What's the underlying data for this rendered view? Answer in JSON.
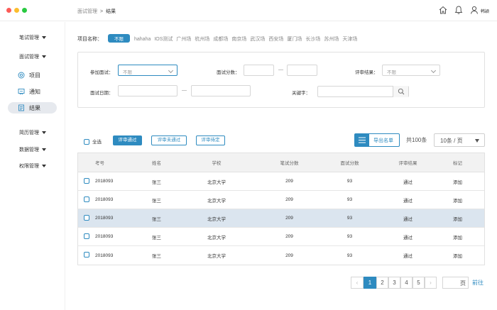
{
  "header": {
    "breadcrumb_parent": "面试管理",
    "breadcrumb_sep": ">",
    "breadcrumb_current": "结果",
    "user_name": "韩颖",
    "icons": [
      "home-icon",
      "bell-icon",
      "user-icon"
    ]
  },
  "sidebar": {
    "groups": [
      {
        "label": "笔试管理"
      },
      {
        "label": "面试管理"
      },
      {
        "label": "简历管理"
      },
      {
        "label": "数据管理"
      },
      {
        "label": "权限管理"
      }
    ],
    "items": [
      {
        "label": "项目",
        "icon": "project-icon"
      },
      {
        "label": "通知",
        "icon": "notice-icon"
      },
      {
        "label": "结果",
        "icon": "result-icon",
        "active": true
      }
    ]
  },
  "project": {
    "label": "项目名称：",
    "selected": "不限",
    "options": [
      "hahaha",
      "IOS测试",
      "广州场",
      "杭州场",
      "成都场",
      "南京场",
      "武汉场",
      "西安场",
      "厦门场",
      "长沙场",
      "苏州场",
      "天津场"
    ]
  },
  "filters": {
    "interview_label": "参加面试：",
    "interview_value": "不限",
    "score_label": "面试分数：",
    "score_dash": "—",
    "result_label": "评审结果：",
    "result_value": "不限",
    "date_label": "面试日期：",
    "date_dash": "—",
    "keyword_label": "关键字："
  },
  "actions": {
    "select_all": "全选",
    "pass": "评审通过",
    "fail": "评审未通过",
    "pending": "评审待定",
    "export": "导出名单",
    "total": "共100条",
    "page_size": "10条 / 页"
  },
  "table": {
    "headers": [
      "考号",
      "姓名",
      "学校",
      "笔试分数",
      "面试分数",
      "评审结果",
      "标记"
    ],
    "rows": [
      [
        "2018093",
        "张三",
        "北京大学",
        "209",
        "93",
        "通过",
        "添加"
      ],
      [
        "2018093",
        "张三",
        "北京大学",
        "209",
        "93",
        "通过",
        "添加"
      ],
      [
        "2018093",
        "张三",
        "北京大学",
        "209",
        "93",
        "通过",
        "添加"
      ],
      [
        "2018093",
        "张三",
        "北京大学",
        "209",
        "93",
        "通过",
        "添加"
      ],
      [
        "2018093",
        "张三",
        "北京大学",
        "209",
        "93",
        "通过",
        "添加"
      ]
    ],
    "highlighted_row": 2
  },
  "pagination": {
    "prev": "‹",
    "next": "›",
    "pages": [
      "1",
      "2",
      "3",
      "4",
      "5"
    ],
    "current": "1",
    "page_unit": "页",
    "goto": "前往"
  },
  "colors": {
    "accent": "#2e8bc0",
    "highlight_row": "#dbe5ef"
  }
}
